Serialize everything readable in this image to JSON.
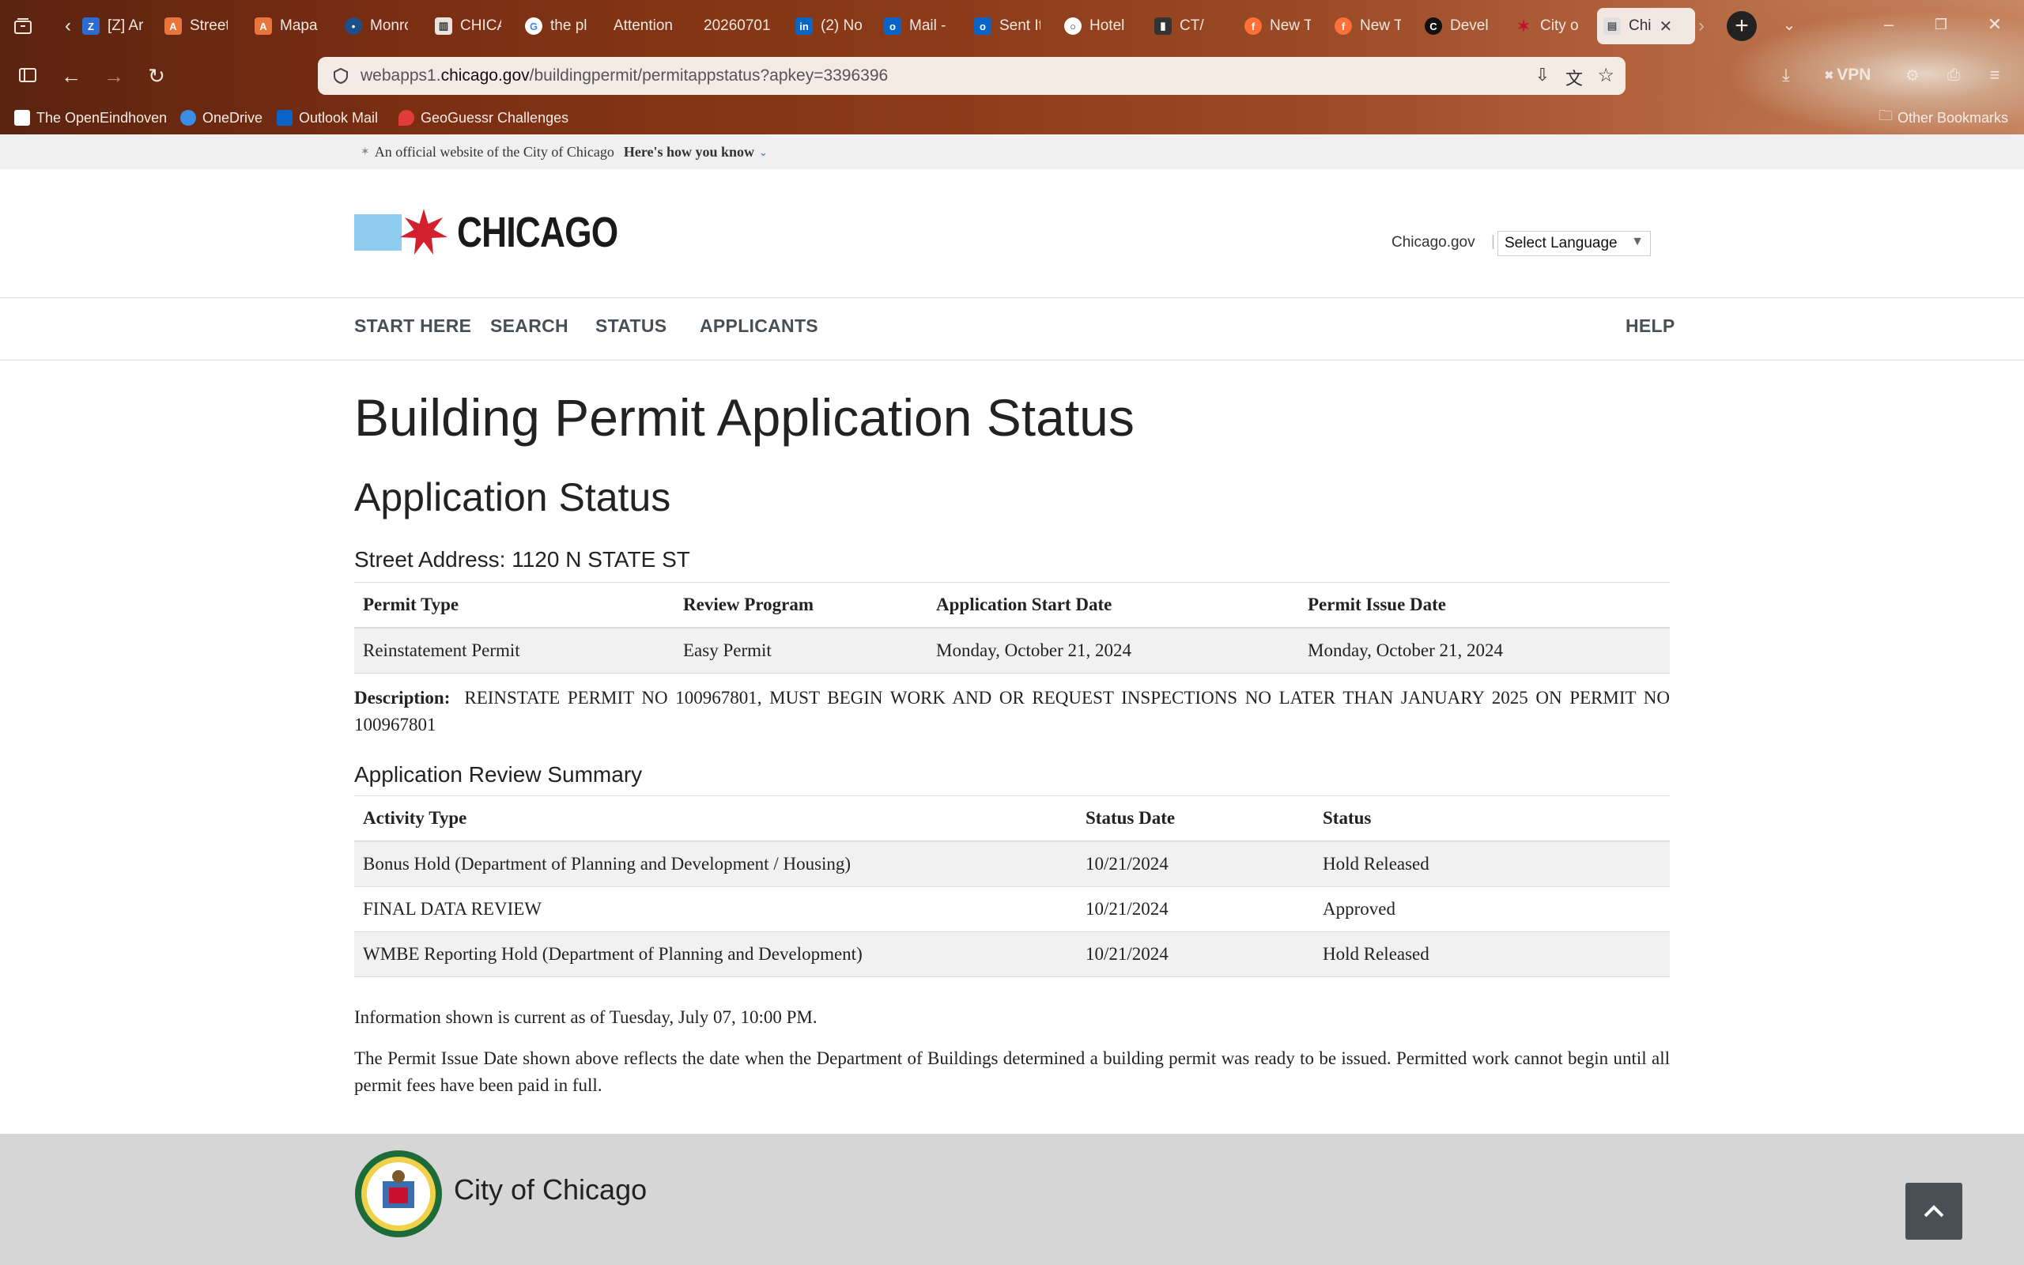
{
  "browser": {
    "tabs": [
      {
        "label": "[Z] Ar",
        "icon": "zillow-icon",
        "color": "#2c6bd1"
      },
      {
        "label": "Street",
        "icon": "translate-icon",
        "color": "#e9753a"
      },
      {
        "label": "Mapa",
        "icon": "translate-icon",
        "color": "#e9753a"
      },
      {
        "label": "Monro",
        "icon": "globe-icon",
        "color": "#1f4f8a"
      },
      {
        "label": "CHICA",
        "icon": "building-icon",
        "color": "#3a3a3a"
      },
      {
        "label": "the pl",
        "icon": "google-icon",
        "color": "#ffffff"
      },
      {
        "label": "Attention",
        "icon": "none",
        "color": "#000000"
      },
      {
        "label": "20260701",
        "icon": "none",
        "color": "#000000"
      },
      {
        "label": "(2) No",
        "icon": "linkedin-icon",
        "color": "#0a66c2"
      },
      {
        "label": "Mail -",
        "icon": "outlook-icon",
        "color": "#0a64c8"
      },
      {
        "label": "Sent It",
        "icon": "outlook-icon",
        "color": "#0a64c8"
      },
      {
        "label": "Hotel",
        "icon": "globe-icon",
        "color": "#ffffff"
      },
      {
        "label": "CT/",
        "icon": "cta-icon",
        "color": "#333333"
      },
      {
        "label": "New T",
        "icon": "firefox-icon",
        "color": "#ff7139"
      },
      {
        "label": "New T",
        "icon": "firefox-icon",
        "color": "#ff7139"
      },
      {
        "label": "Devel",
        "icon": "c-icon",
        "color": "#111111"
      },
      {
        "label": "City o",
        "icon": "star-icon",
        "color": "#c8102e"
      },
      {
        "label": "Chi",
        "icon": "page-icon",
        "color": "#777777"
      }
    ],
    "url_prefix": "webapps1.",
    "url_host": "chicago.gov",
    "url_path": "/buildingpermit/permitappstatus?apkey=3396396",
    "vpn_label": "VPN",
    "bookmarks": [
      {
        "label": "The OpenEindhoven",
        "icon": "page-icon"
      },
      {
        "label": "OneDrive",
        "icon": "cloud-icon"
      },
      {
        "label": "Outlook Mail",
        "icon": "outlook-icon"
      },
      {
        "label": "GeoGuessr Challenges",
        "icon": "pin-icon"
      }
    ],
    "other_bookmarks": "Other Bookmarks"
  },
  "official": {
    "text": "An official website of the City of Chicago",
    "how": "Here's how you know"
  },
  "header": {
    "logo_text": "CHICAGO",
    "chicago_gov": "Chicago.gov",
    "language": "Select Language"
  },
  "nav": {
    "start": "START HERE",
    "search": "SEARCH",
    "status": "STATUS",
    "applicants": "APPLICANTS",
    "help": "HELP"
  },
  "page": {
    "title": "Building Permit Application Status",
    "subtitle": "Application Status",
    "street_label": "Street Address:",
    "street_value": "1120 N STATE ST"
  },
  "permit_table": {
    "headers": [
      "Permit Type",
      "Review Program",
      "Application Start Date",
      "Permit Issue Date"
    ],
    "rows": [
      [
        "Reinstatement Permit",
        "Easy Permit",
        "Monday, October 21, 2024",
        "Monday, October 21, 2024"
      ]
    ]
  },
  "description": {
    "label": "Description:",
    "text": "REINSTATE PERMIT NO 100967801, MUST BEGIN WORK AND OR REQUEST INSPECTIONS NO LATER THAN JANUARY 2025 ON PERMIT NO 100967801"
  },
  "review": {
    "title": "Application Review Summary",
    "headers": [
      "Activity Type",
      "Status Date",
      "Status"
    ],
    "rows": [
      [
        "Bonus Hold (Department of Planning and Development / Housing)",
        "10/21/2024",
        "Hold Released"
      ],
      [
        "FINAL DATA REVIEW",
        "10/21/2024",
        "Approved"
      ],
      [
        "WMBE Reporting Hold (Department of Planning and Development)",
        "10/21/2024",
        "Hold Released"
      ]
    ]
  },
  "info": {
    "current": "Information shown is current as of Tuesday, July 07, 10:00 PM.",
    "note": "The Permit Issue Date shown above reflects the date when the Department of Buildings determined a building permit was ready to be issued. Permitted work cannot begin until all permit fees have been paid in full."
  },
  "footer": {
    "title": "City of Chicago"
  }
}
